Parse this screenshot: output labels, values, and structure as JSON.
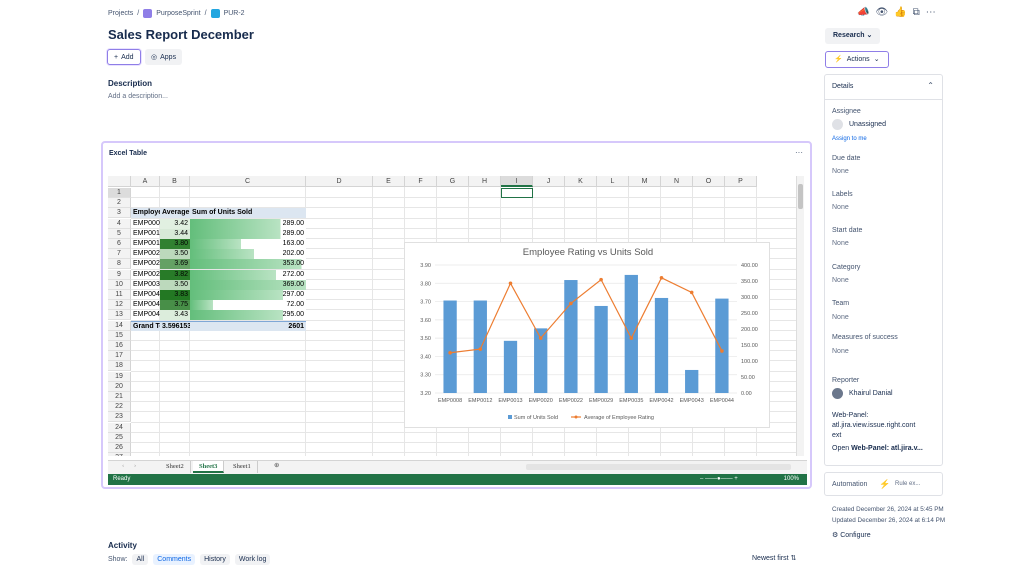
{
  "breadcrumb": {
    "projects": "Projects",
    "project": "PurposeSprint",
    "issue": "PUR-2"
  },
  "issue": {
    "title": "Sales Report December",
    "add_label": "Add",
    "apps_label": "Apps",
    "description_heading": "Description",
    "description_placeholder": "Add a description..."
  },
  "excel": {
    "title": "Excel Table",
    "more": "···",
    "columns": [
      "A",
      "B",
      "C",
      "D",
      "E",
      "F",
      "G",
      "H",
      "I",
      "J",
      "K",
      "L",
      "M",
      "N",
      "O",
      "P"
    ],
    "rows": [
      "1",
      "2",
      "3",
      "4",
      "5",
      "6",
      "7",
      "8",
      "9",
      "10",
      "11",
      "12",
      "13",
      "14",
      "15",
      "16",
      "17",
      "18",
      "19",
      "20",
      "21",
      "22",
      "23",
      "24",
      "25",
      "26",
      "27"
    ],
    "headers": {
      "id": "Employee ID",
      "rating": "Average of Employee Rating",
      "units": "Sum of Units Sold"
    },
    "table": [
      {
        "id": "EMP0008",
        "rating": "3.42",
        "units": "289.00"
      },
      {
        "id": "EMP0012",
        "rating": "3.44",
        "units": "289.00"
      },
      {
        "id": "EMP0013",
        "rating": "3.80",
        "units": "163.00"
      },
      {
        "id": "EMP0020",
        "rating": "3.50",
        "units": "202.00"
      },
      {
        "id": "EMP0022",
        "rating": "3.69",
        "units": "353.00"
      },
      {
        "id": "EMP0029",
        "rating": "3.82",
        "units": "272.00"
      },
      {
        "id": "EMP0035",
        "rating": "3.50",
        "units": "369.00"
      },
      {
        "id": "EMP0042",
        "rating": "3.83",
        "units": "297.00"
      },
      {
        "id": "EMP0043",
        "rating": "3.75",
        "units": "72.00"
      },
      {
        "id": "EMP0044",
        "rating": "3.43",
        "units": "295.00"
      }
    ],
    "grand_total": {
      "label": "Grand Total",
      "rating": "3.5961538461538",
      "units": "2601"
    },
    "sheet_tabs": [
      "Sheet2",
      "Sheet3",
      "Sheet1"
    ],
    "active_sheet": "Sheet3",
    "status": "Ready",
    "zoom": "100%"
  },
  "chart_data": {
    "type": "bar",
    "title": "Employee Rating vs Units Sold",
    "categories": [
      "EMP0008",
      "EMP0012",
      "EMP0013",
      "EMP0020",
      "EMP0022",
      "EMP0029",
      "EMP0035",
      "EMP0042",
      "EMP0043",
      "EMP0044"
    ],
    "series": [
      {
        "name": "Sum of Units Sold",
        "type": "bar",
        "axis": "right",
        "values": [
          289,
          289,
          163,
          202,
          353,
          272,
          369,
          297,
          72,
          295
        ],
        "color": "#5b9bd5"
      },
      {
        "name": "Average of Employee Rating",
        "type": "line",
        "axis": "left",
        "values": [
          3.42,
          3.44,
          3.8,
          3.5,
          3.69,
          3.82,
          3.5,
          3.83,
          3.75,
          3.43
        ],
        "color": "#ed7d31"
      }
    ],
    "left_axis": {
      "ylim": [
        3.2,
        3.9
      ],
      "ticks": [
        "3.20",
        "3.30",
        "3.40",
        "3.50",
        "3.60",
        "3.70",
        "3.80",
        "3.90"
      ]
    },
    "right_axis": {
      "ylim": [
        0,
        400
      ],
      "ticks": [
        "0.00",
        "50.00",
        "100.00",
        "150.00",
        "200.00",
        "250.00",
        "300.00",
        "350.00",
        "400.00"
      ]
    },
    "legend": "bottom",
    "grid": true
  },
  "activity": {
    "heading": "Activity",
    "show_label": "Show:",
    "filters": [
      "All",
      "Comments",
      "History",
      "Work log"
    ],
    "selected": "Comments",
    "sort": "Newest first"
  },
  "sidebar": {
    "research": "Research",
    "actions": "Actions",
    "details_heading": "Details",
    "fields": [
      {
        "label": "Assignee",
        "value": "Unassigned",
        "extra": "Assign to me"
      },
      {
        "label": "Due date",
        "value": "None"
      },
      {
        "label": "Labels",
        "value": "None"
      },
      {
        "label": "Start date",
        "value": "None"
      },
      {
        "label": "Category",
        "value": "None"
      },
      {
        "label": "Team",
        "value": "None"
      },
      {
        "label": "Measures of success",
        "value": "None"
      }
    ],
    "reporter_label": "Reporter",
    "reporter": "Khairul Danial",
    "webpanel_line1": "Web-Panel:",
    "webpanel_line2": "atl.jira.view.issue.right.cont",
    "webpanel_line3": "ext",
    "webpanel_open": "Open",
    "webpanel_link": "Web-Panel: atl.jira.v...",
    "automation": "Automation",
    "rule": "Rule ex...",
    "created": "Created December 26, 2024 at 5:45 PM",
    "updated": "Updated December 26, 2024 at 6:14 PM",
    "configure": "Configure"
  }
}
